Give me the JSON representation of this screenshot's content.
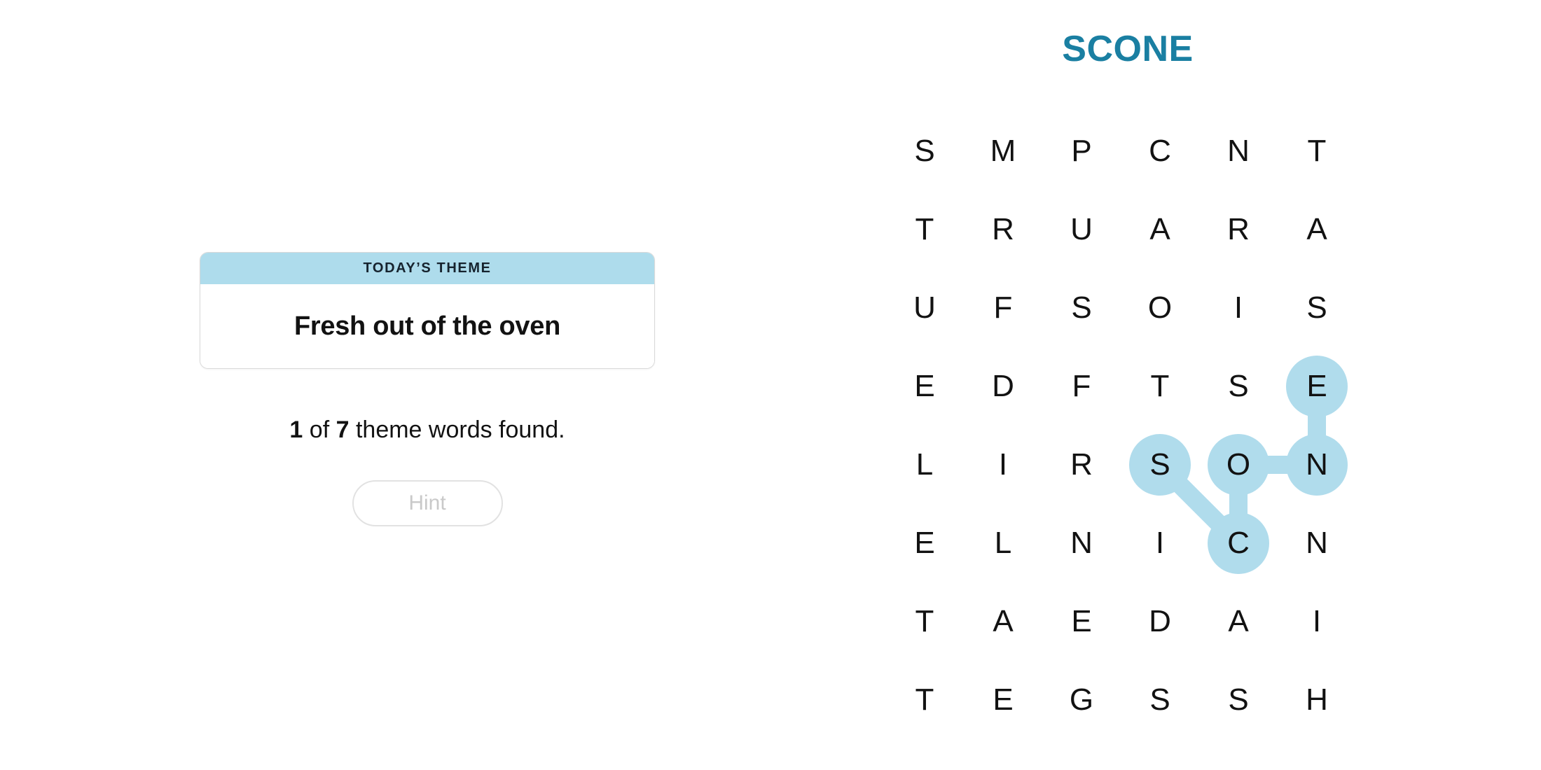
{
  "puzzle": {
    "title": "SCONE",
    "title_color": "#1a7fa2"
  },
  "theme_card": {
    "header_label": "TODAY’S THEME",
    "theme_text": "Fresh out of the oven",
    "header_color": "#aedcec"
  },
  "progress": {
    "found_count": "1",
    "total_count": "7",
    "prefix": "",
    "mid": " of ",
    "suffix": " theme words found."
  },
  "hint_button": {
    "label": "Hint",
    "disabled": true
  },
  "grid": {
    "rows": 8,
    "cols": 6,
    "letters": [
      [
        "S",
        "M",
        "P",
        "C",
        "N",
        "T"
      ],
      [
        "T",
        "R",
        "U",
        "A",
        "R",
        "A"
      ],
      [
        "U",
        "F",
        "S",
        "O",
        "I",
        "S"
      ],
      [
        "E",
        "D",
        "F",
        "T",
        "S",
        "E"
      ],
      [
        "L",
        "I",
        "R",
        "S",
        "O",
        "N"
      ],
      [
        "E",
        "L",
        "N",
        "I",
        "C",
        "N"
      ],
      [
        "T",
        "A",
        "E",
        "D",
        "A",
        "I"
      ],
      [
        "T",
        "E",
        "G",
        "S",
        "S",
        "H"
      ]
    ],
    "highlight_color": "#b0dcec",
    "found_words": [
      {
        "word": "SCONE",
        "path": [
          {
            "row": 4,
            "col": 3
          },
          {
            "row": 5,
            "col": 4
          },
          {
            "row": 4,
            "col": 4
          },
          {
            "row": 4,
            "col": 5
          },
          {
            "row": 3,
            "col": 5
          }
        ]
      }
    ]
  }
}
